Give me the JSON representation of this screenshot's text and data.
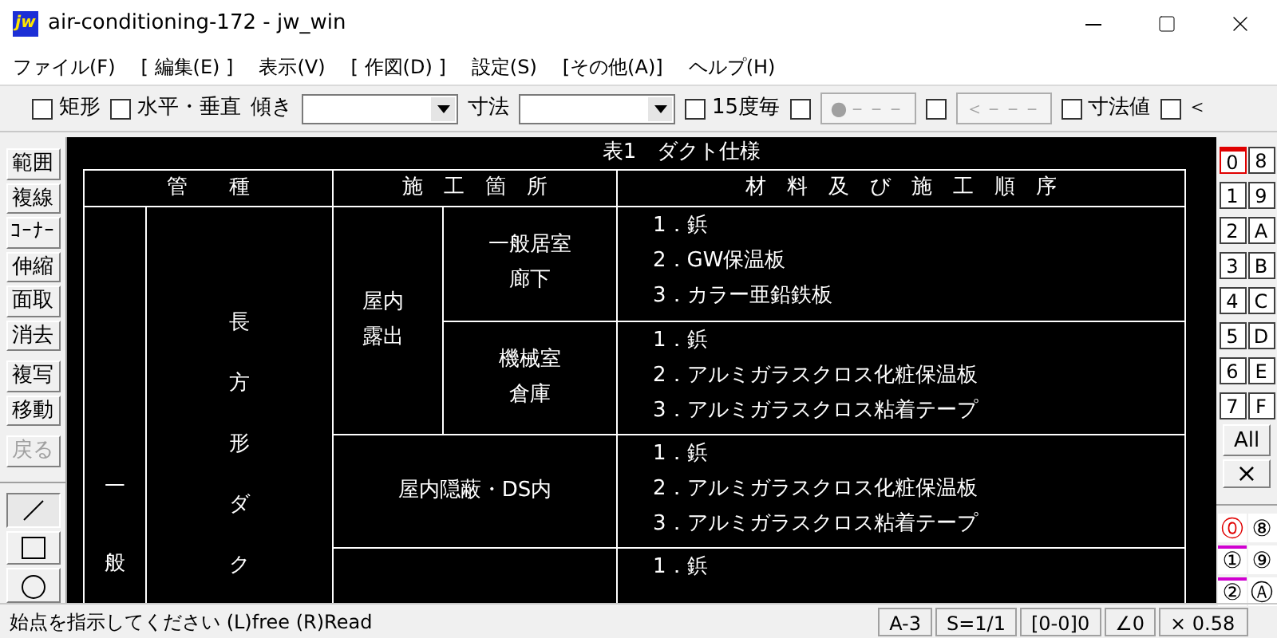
{
  "window": {
    "app_icon": "jw",
    "title": "air-conditioning-172 - jw_win"
  },
  "menu": [
    "ファイル(F)",
    "[ 編集(E) ]",
    "表示(V)",
    "[ 作図(D) ]",
    "設定(S)",
    "[その他(A)]",
    "ヘルプ(H)"
  ],
  "toolbar": [
    {
      "kind": "checkbox",
      "label": "矩形",
      "checked": false
    },
    {
      "kind": "checkbox",
      "label": "水平・垂直",
      "checked": false
    },
    {
      "kind": "label",
      "label": "傾き"
    },
    {
      "kind": "dropdown"
    },
    {
      "kind": "label",
      "label": "寸法"
    },
    {
      "kind": "dropdown"
    },
    {
      "kind": "checkbox",
      "label": "15度毎",
      "checked": false
    },
    {
      "kind": "checkbox",
      "checked": false
    },
    {
      "kind": "button",
      "label": "●－－－",
      "disabled": true
    },
    {
      "kind": "checkbox",
      "checked": false
    },
    {
      "kind": "button",
      "label": "＜－－－",
      "disabled": true
    },
    {
      "kind": "checkbox",
      "label": "寸法値",
      "checked": false
    },
    {
      "kind": "checkbox",
      "label": "＜",
      "checked": false
    }
  ],
  "tools": [
    {
      "kind": "text",
      "label": "範囲",
      "disabled": false
    },
    {
      "kind": "text",
      "label": "複線",
      "disabled": false
    },
    {
      "kind": "text",
      "label": "ｺｰﾅｰ",
      "disabled": false
    },
    {
      "kind": "text",
      "label": "伸縮",
      "disabled": false
    },
    {
      "kind": "text",
      "label": "面取",
      "disabled": false
    },
    {
      "kind": "text",
      "label": "消去",
      "disabled": false
    },
    {
      "kind": "text",
      "label": "複写",
      "disabled": false
    },
    {
      "kind": "text",
      "label": "移動",
      "disabled": false
    },
    {
      "kind": "text",
      "label": "戻る",
      "disabled": true
    },
    {
      "kind": "line",
      "selected": true
    },
    {
      "kind": "rect",
      "selected": false
    },
    {
      "kind": "circle",
      "selected": false
    }
  ],
  "drawing": {
    "title": "表1　ダクト仕様",
    "headers": [
      "管　　種",
      "施　工　箇　所",
      "材　料　及　び　施　工　順　序"
    ],
    "category": "一般",
    "duct_type": "長方形ダク",
    "locations": [
      {
        "lines": [
          "屋内",
          "露出"
        ],
        "sub": [
          {
            "lines": [
              "一般居室",
              "廊下"
            ],
            "materials": [
              "1．鋲",
              "2．GW保温板",
              "3．カラー亜鉛鉄板"
            ]
          },
          {
            "lines": [
              "機械室",
              "倉庫"
            ],
            "materials": [
              "1．鋲",
              "2．アルミガラスクロス化粧保温板",
              "3．アルミガラスクロス粘着テープ"
            ]
          }
        ]
      },
      {
        "lines": [
          "屋内隠蔽・DS内"
        ],
        "materials": [
          "1．鋲",
          "2．アルミガラスクロス化粧保温板",
          "3．アルミガラスクロス粘着テープ"
        ]
      },
      {
        "materials": [
          "1．鋲"
        ]
      }
    ]
  },
  "layers": [
    {
      "label": "0",
      "selected": true
    },
    {
      "label": "8",
      "selected": false
    },
    {
      "label": "1",
      "selected": false
    },
    {
      "label": "9",
      "selected": false
    },
    {
      "label": "2",
      "selected": false
    },
    {
      "label": "A",
      "selected": false
    },
    {
      "label": "3",
      "selected": false
    },
    {
      "label": "B",
      "selected": false
    },
    {
      "label": "4",
      "selected": false
    },
    {
      "label": "C",
      "selected": false
    },
    {
      "label": "5",
      "selected": false
    },
    {
      "label": "D",
      "selected": false
    },
    {
      "label": "6",
      "selected": false
    },
    {
      "label": "E",
      "selected": false
    },
    {
      "label": "7",
      "selected": false
    },
    {
      "label": "F",
      "selected": false
    }
  ],
  "layer_all": "All",
  "layer_clear": "×",
  "layer_groups": [
    {
      "label": "⓪",
      "selected": true,
      "marked": false
    },
    {
      "label": "⑧",
      "selected": false,
      "marked": false
    },
    {
      "label": "①",
      "selected": false,
      "marked": true
    },
    {
      "label": "⑨",
      "selected": false,
      "marked": false
    },
    {
      "label": "②",
      "selected": false,
      "marked": true
    },
    {
      "label": "Ⓐ",
      "selected": false,
      "marked": false
    }
  ],
  "status_bar": {
    "message": "始点を指示してください (L)free (R)Read",
    "fields": [
      "A-3",
      "S=1/1",
      "[0-0]0",
      "∠0",
      "× 0.58"
    ]
  }
}
